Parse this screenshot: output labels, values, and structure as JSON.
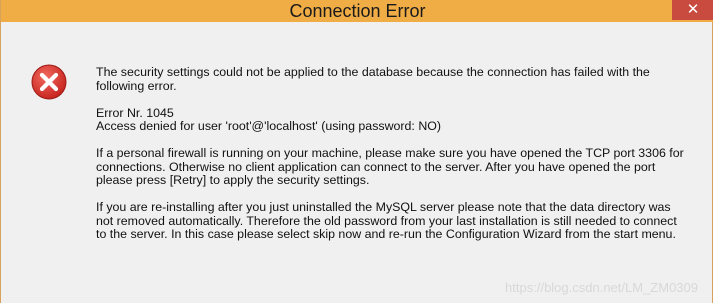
{
  "window": {
    "title": "Connection Error",
    "close_label": "✕"
  },
  "icon": {
    "name": "error-icon",
    "color": "#d9342c"
  },
  "message": {
    "p1": "The security settings could not be applied to the database because the connection has failed with the following error.",
    "error_line1": "Error Nr. 1045",
    "error_line2": "Access denied for user 'root'@'localhost' (using password: NO)",
    "p3": "If a personal firewall is running on your machine, please make sure you have opened the TCP port 3306 for connections. Otherwise no client application can connect to the server. After you have opened the port please press [Retry] to apply the security settings.",
    "p4": "If you are re-installing after you just uninstalled the MySQL server please note that the data directory was not removed automatically. Therefore the old password from your last installation is still needed to connect to the server. In this case please select skip now and re-run the Configuration Wizard from the start menu."
  },
  "watermark": "https://blog.csdn.net/LM_ZM0309"
}
